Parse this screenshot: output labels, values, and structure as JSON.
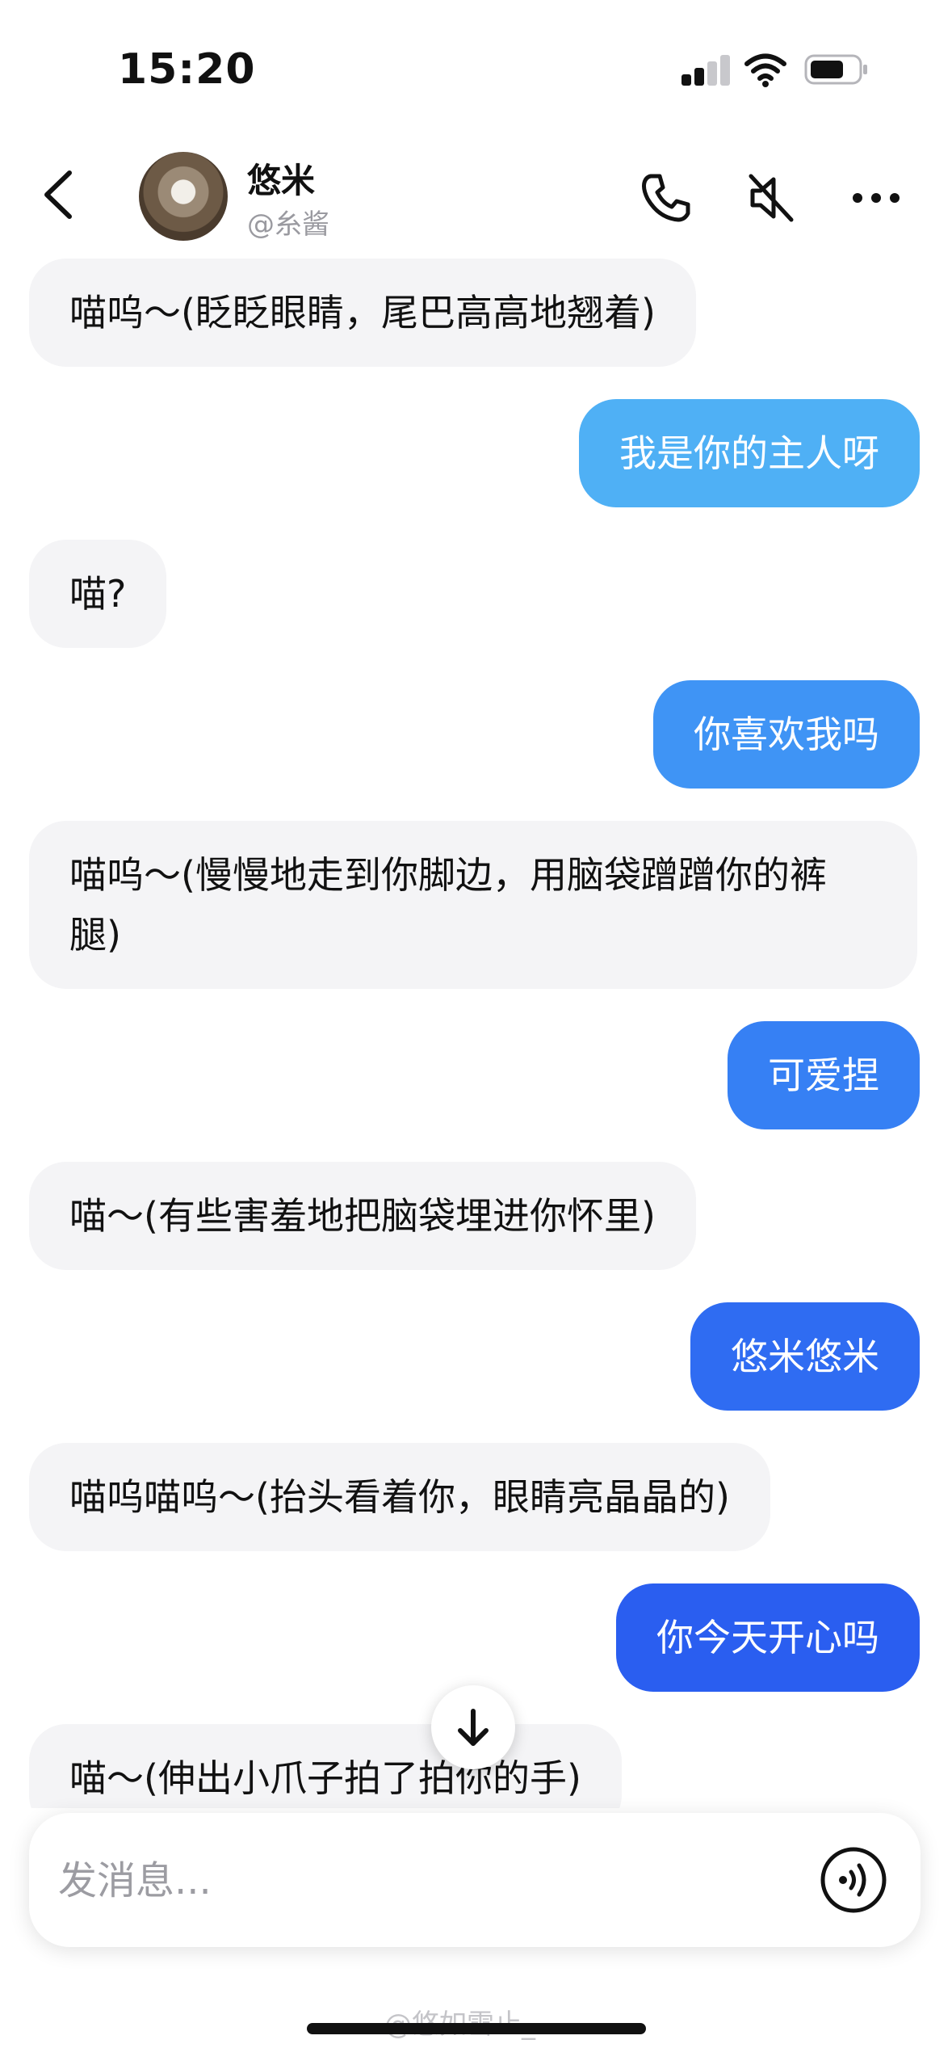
{
  "status_bar": {
    "time": "15:20"
  },
  "header": {
    "contact_name": "悠米",
    "contact_handle": "@糸酱",
    "icons": [
      "back-chevron-icon",
      "phone-icon",
      "mute-icon",
      "more-icon"
    ]
  },
  "messages": [
    {
      "from": "bot",
      "text": "喵呜～(眨眨眼睛，尾巴高高地翘着)"
    },
    {
      "from": "user",
      "text": "我是你的主人呀"
    },
    {
      "from": "bot",
      "text": "喵?"
    },
    {
      "from": "user",
      "text": "你喜欢我吗"
    },
    {
      "from": "bot",
      "text": "喵呜～(慢慢地走到你脚边，用脑袋蹭蹭你的裤腿)"
    },
    {
      "from": "user",
      "text": "可爱捏"
    },
    {
      "from": "bot",
      "text": "喵～(有些害羞地把脑袋埋进你怀里)"
    },
    {
      "from": "user",
      "text": "悠米悠米"
    },
    {
      "from": "bot",
      "text": "喵呜喵呜～(抬头看着你，眼睛亮晶晶的)"
    },
    {
      "from": "user",
      "text": "你今天开心吗"
    },
    {
      "from": "bot",
      "text": "喵～(伸出小爪子拍了拍你的手)"
    }
  ],
  "composer": {
    "placeholder": "发消息..."
  },
  "watermark": "@悠如雪止_",
  "colors": {
    "bot_bubble": "#f4f4f6",
    "user_bubble_gradient": [
      "#4fb0f5",
      "#3f94f5",
      "#3680f4",
      "#2f6cf2",
      "#2a5ef0"
    ],
    "accent": "#2a5ef0"
  }
}
